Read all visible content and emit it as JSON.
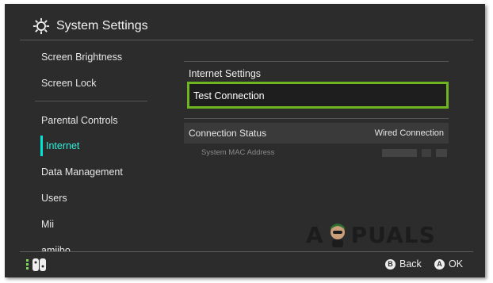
{
  "header": {
    "title": "System Settings",
    "icon": "gear-icon"
  },
  "sidebar": {
    "items": [
      {
        "label": "Screen Brightness"
      },
      {
        "label": "Screen Lock"
      },
      {
        "label": "Parental Controls"
      },
      {
        "label": "Internet",
        "active": true
      },
      {
        "label": "Data Management"
      },
      {
        "label": "Users"
      },
      {
        "label": "Mii"
      },
      {
        "label": "amiibo"
      }
    ]
  },
  "content": {
    "section_title": "Internet Settings",
    "test_button_label": "Test Connection",
    "connection_status_label": "Connection Status",
    "connection_status_value": "Wired Connection",
    "mac_label": "System MAC Address"
  },
  "footer": {
    "back_key": "B",
    "back_label": "Back",
    "ok_key": "A",
    "ok_label": "OK"
  },
  "watermark": {
    "text_left": "A",
    "text_right": "PUALS"
  },
  "colors": {
    "background": "#2c2c2c",
    "active": "#2ef0dd",
    "focus_border": "#6fb51f"
  }
}
